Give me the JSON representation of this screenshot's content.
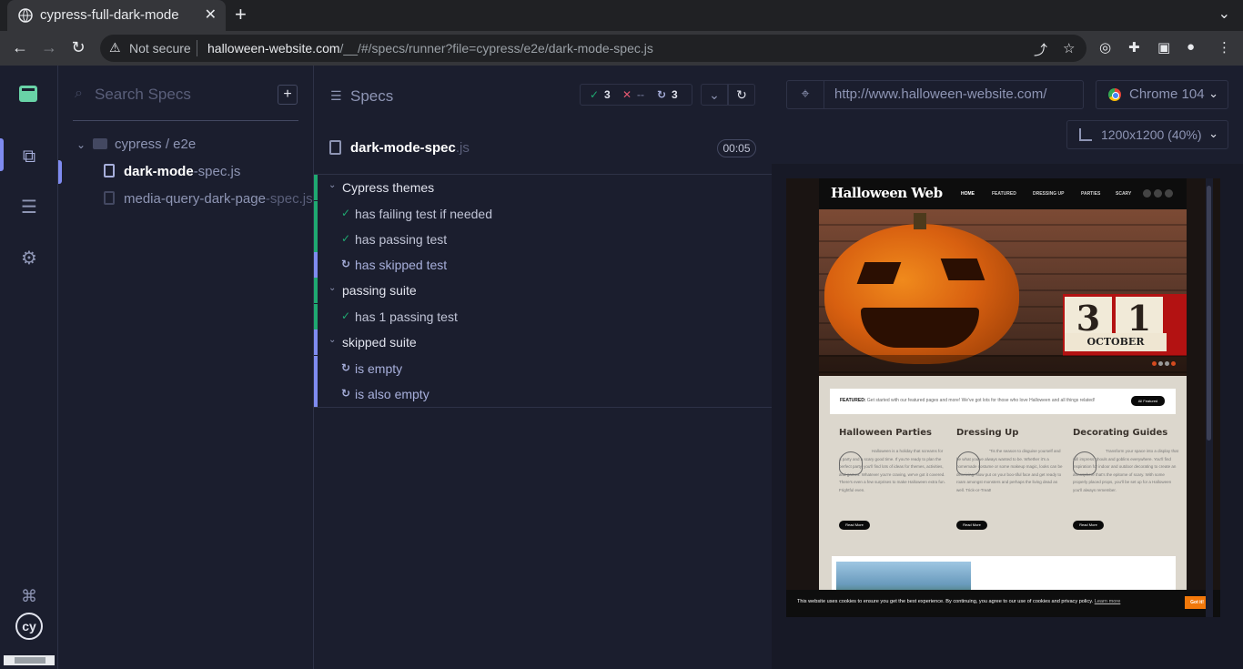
{
  "browser": {
    "tab_title": "cypress-full-dark-mode",
    "not_secure": "Not secure",
    "url_host": "halloween-website.com",
    "url_rest": "/__/#/specs/runner?file=cypress/e2e/dark-mode-spec.js"
  },
  "specs": {
    "search_placeholder": "Search Specs",
    "folder": "cypress / e2e",
    "items": [
      {
        "name": "dark-mode",
        "ext": "-spec.js"
      },
      {
        "name": "media-query-dark-page",
        "ext": "-spec.js"
      }
    ]
  },
  "reporter": {
    "title": "Specs",
    "stats": {
      "passed": "3",
      "failed": "--",
      "pending": "3"
    },
    "spec_name": "dark-mode-spec",
    "spec_ext": ".js",
    "duration": "00:05",
    "rows": [
      {
        "type": "suite",
        "label": "Cypress themes"
      },
      {
        "type": "pass",
        "label": "has failing test if needed"
      },
      {
        "type": "pass",
        "label": "has passing test"
      },
      {
        "type": "skip",
        "label": "has skipped test"
      },
      {
        "type": "suite",
        "label": "passing suite"
      },
      {
        "type": "pass",
        "label": "has 1 passing test"
      },
      {
        "type": "suite",
        "label": "skipped suite"
      },
      {
        "type": "skip",
        "label": "is empty"
      },
      {
        "type": "skip",
        "label": "is also empty"
      }
    ]
  },
  "aut": {
    "url": "http://www.halloween-website.com/",
    "browser": "Chrome 104",
    "viewport": "1200x1200 (40%)"
  },
  "site": {
    "logo": "Halloween Web",
    "menu": [
      "HOME",
      "FEATURED",
      "DRESSING UP",
      "PARTIES",
      "SCARY"
    ],
    "calendar_day1": "3",
    "calendar_day2": "1",
    "calendar_month": "OCTOBER",
    "featured_label": "FEATURED:",
    "featured_text": "Get started with our featured pages and more! We've got lots for those who love Halloween and all things related!",
    "featured_button": "All Featured",
    "columns": [
      {
        "title": "Halloween Parties",
        "text": "Halloween is a holiday that screams for a party and a scary good time. If you're ready to plan the perfect party, you'll find lots of ideas for themes, activities, and games. Whatever you're craving, we've got it covered. There's even a few surprises to make Halloween extra fun. Frightful even.",
        "button": "Read More"
      },
      {
        "title": "Dressing Up",
        "text": "'Tis the season to disguise yourself and be what you've always wanted to be. Whether it's a homemade costume or some makeup magic, looks can be deceiving. Now put on your boo-tiful face and get ready to roam amongst monsters and perhaps the living dead as well. Trick-or-Treat!",
        "button": "Read More"
      },
      {
        "title": "Decorating Guides",
        "text": "Transform your space into a display that will impress ghouls and goblins everywhere. You'll find inspiration for indoor and outdoor decorating to create an atmosphere that's the epitome of scary. With some properly placed props, you'll be set up for a Halloween you'll always remember.",
        "button": "Read More"
      }
    ],
    "cookie_text": "This website uses cookies to ensure you get the best experience. By continuing, you agree to our use of cookies and privacy policy.",
    "cookie_link": "Learn more",
    "cookie_button": "Got it!"
  },
  "colors": {
    "pass": "#1fa971",
    "fail": "#e45770",
    "skip": "#a7afdb",
    "accent": "#7f8bf0"
  }
}
